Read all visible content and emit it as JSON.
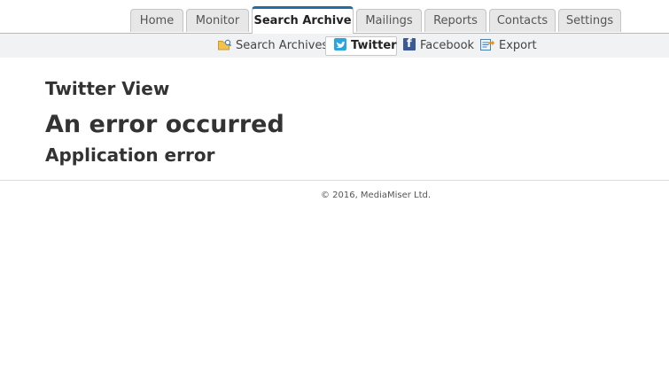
{
  "nav": {
    "tabs": [
      {
        "label": "Home"
      },
      {
        "label": "Monitor"
      },
      {
        "label": "Search Archive"
      },
      {
        "label": "Mailings"
      },
      {
        "label": "Reports"
      },
      {
        "label": "Contacts"
      },
      {
        "label": "Settings"
      }
    ],
    "active_tab": "Search Archive"
  },
  "subnav": {
    "items": [
      {
        "label": "Search Archives",
        "icon": "folder-search-icon"
      },
      {
        "label": "Twitter",
        "icon": "twitter-icon"
      },
      {
        "label": "Facebook",
        "icon": "facebook-icon"
      },
      {
        "label": "Export",
        "icon": "export-icon"
      }
    ],
    "active_item": "Twitter"
  },
  "main": {
    "view_title": "Twitter View",
    "error_title": "An error occurred",
    "error_message": "Application error"
  },
  "footer": {
    "copyright": "© 2016, MediaMiser Ltd."
  },
  "colors": {
    "active_tab_border": "#1f6fa6",
    "twitter": "#2ba5e0",
    "facebook": "#3b5998"
  }
}
